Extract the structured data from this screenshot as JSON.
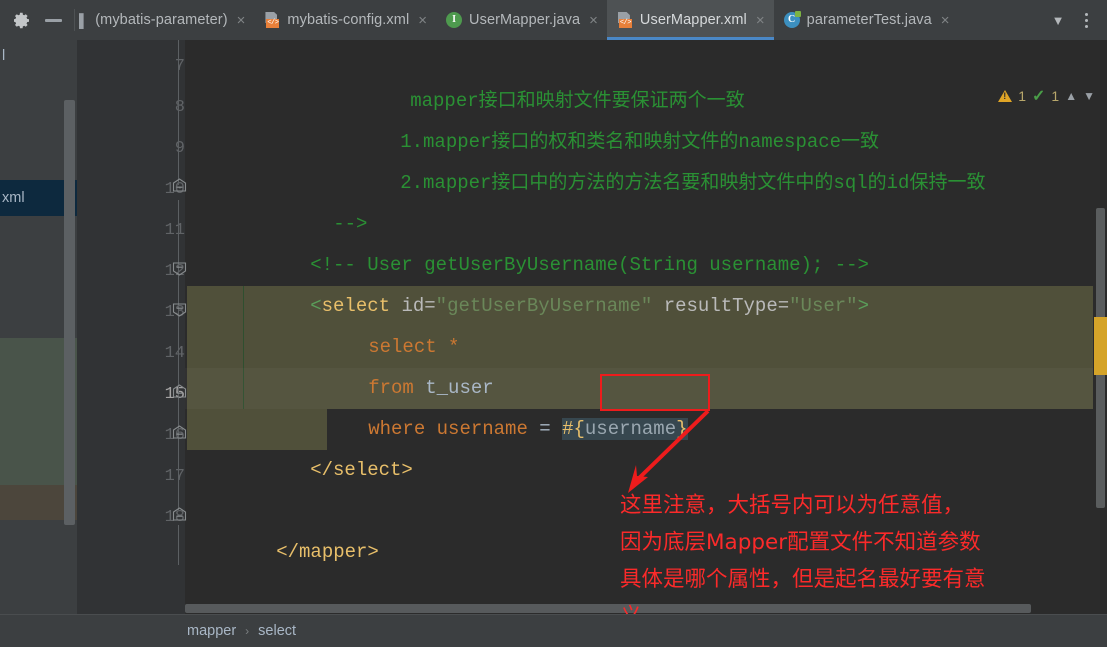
{
  "toolbar": {
    "gear_icon": "gear-icon",
    "minimize_icon": "minimize-icon"
  },
  "tabs": [
    {
      "label": "(mybatis-parameter)",
      "icon": "bar-icon",
      "close": "×",
      "active": false
    },
    {
      "label": "mybatis-config.xml",
      "icon": "xml-file-icon",
      "close": "×",
      "active": false
    },
    {
      "label": "UserMapper.java",
      "icon": "java-interface-icon",
      "close": "×",
      "active": false
    },
    {
      "label": "UserMapper.xml",
      "icon": "xml-file-icon",
      "close": "×",
      "active": true
    },
    {
      "label": "parameterTest.java",
      "icon": "java-test-icon",
      "close": "×",
      "active": false
    }
  ],
  "tab_controls": {
    "dropdown_icon": "chevron-down-icon",
    "more_icon": "kebab-menu-icon"
  },
  "inspection": {
    "warning_icon": "warning-triangle-icon",
    "warning_count": "1",
    "ok_icon": "check-mark-icon",
    "ok_count": "1",
    "prev_icon": "chevron-up-icon",
    "next_icon": "chevron-down-icon"
  },
  "left_panel": {
    "truncated_item": "xml",
    "edge_marker": "l"
  },
  "editor": {
    "current_line": 15,
    "lines": [
      {
        "n": 7,
        "fold": false,
        "text": "            mapper接口和映射文件要保证两个一致"
      },
      {
        "n": 8,
        "fold": false,
        "text": "            1.mapper接口的权和类名和映射文件的namespace一致"
      },
      {
        "n": 9,
        "fold": false,
        "text": "            2.mapper接口中的方法的方法名要和映射文件中的sql的id保持一致"
      },
      {
        "n": 10,
        "fold": true,
        "text": "     -->"
      },
      {
        "n": 11,
        "fold": false,
        "text": "    <!-- User getUserByUsername(String username); -->"
      },
      {
        "n": 12,
        "fold": true,
        "text": "    <select id=\"getUserByUsername\" resultType=\"User\">"
      },
      {
        "n": 13,
        "fold": true,
        "text": "        select *"
      },
      {
        "n": 14,
        "fold": false,
        "text": "        from t_user"
      },
      {
        "n": 15,
        "fold": true,
        "text": "        where username = #{username}"
      },
      {
        "n": 16,
        "fold": true,
        "text": "    </select>"
      },
      {
        "n": 17,
        "fold": false,
        "text": ""
      },
      {
        "n": 18,
        "fold": true,
        "text": "</mapper>"
      }
    ],
    "tokens": {
      "comment_line7": "mapper接口和映射文件要保证两个一致",
      "comment_line8": "1.mapper接口的权和类名和映射文件的namespace一致",
      "comment_line9": "2.mapper接口中的方法的方法名要和映射文件中的sql的id保持一致",
      "comment_close": "-->",
      "comment_line11": "<!-- User getUserByUsername(String username); -->",
      "select_open_lt": "<",
      "select_open_tag": "select",
      "select_attr_id": "id",
      "select_eq": "=",
      "select_id_value": "\"getUserByUsername\"",
      "select_attr_result": "resultType",
      "select_result_value": "\"User\"",
      "select_open_gt": ">",
      "sql_select": "select",
      "sql_star": "*",
      "sql_from": "from",
      "sql_table": "t_user",
      "sql_where": "where",
      "sql_col": "username",
      "sql_eq": "=",
      "sql_hash": "#{",
      "sql_param": "username",
      "sql_brace_close": "}",
      "select_close": "</select>",
      "mapper_close": "</mapper>"
    }
  },
  "annotation": {
    "highlight_box": "username-parameter-highlight",
    "arrow": "red-arrow-icon",
    "lines": [
      "这里注意，大括号内可以为任意值，",
      "因为底层Mapper配置文件不知道参数",
      "具体是哪个属性，但是起名最好要有意",
      "义"
    ],
    "color": "#fb2a2a"
  },
  "breadcrumb": {
    "items": [
      "mapper",
      "select"
    ],
    "separator": "›"
  },
  "colors": {
    "editor_bg": "#2b2b2b",
    "gutter_bg": "#313335",
    "panel_bg": "#3c3f41",
    "tab_active_bg": "#4e5254",
    "tab_underline": "#4a88c7",
    "sql_injection_bg": "#50503a",
    "comment_green": "#2a9134",
    "tag_orange": "#e8bf6a",
    "string_green": "#6a8759",
    "keyword_orange": "#cc7832",
    "annotation_red": "#fb2a2a",
    "warning_yellow": "#d5a429"
  }
}
